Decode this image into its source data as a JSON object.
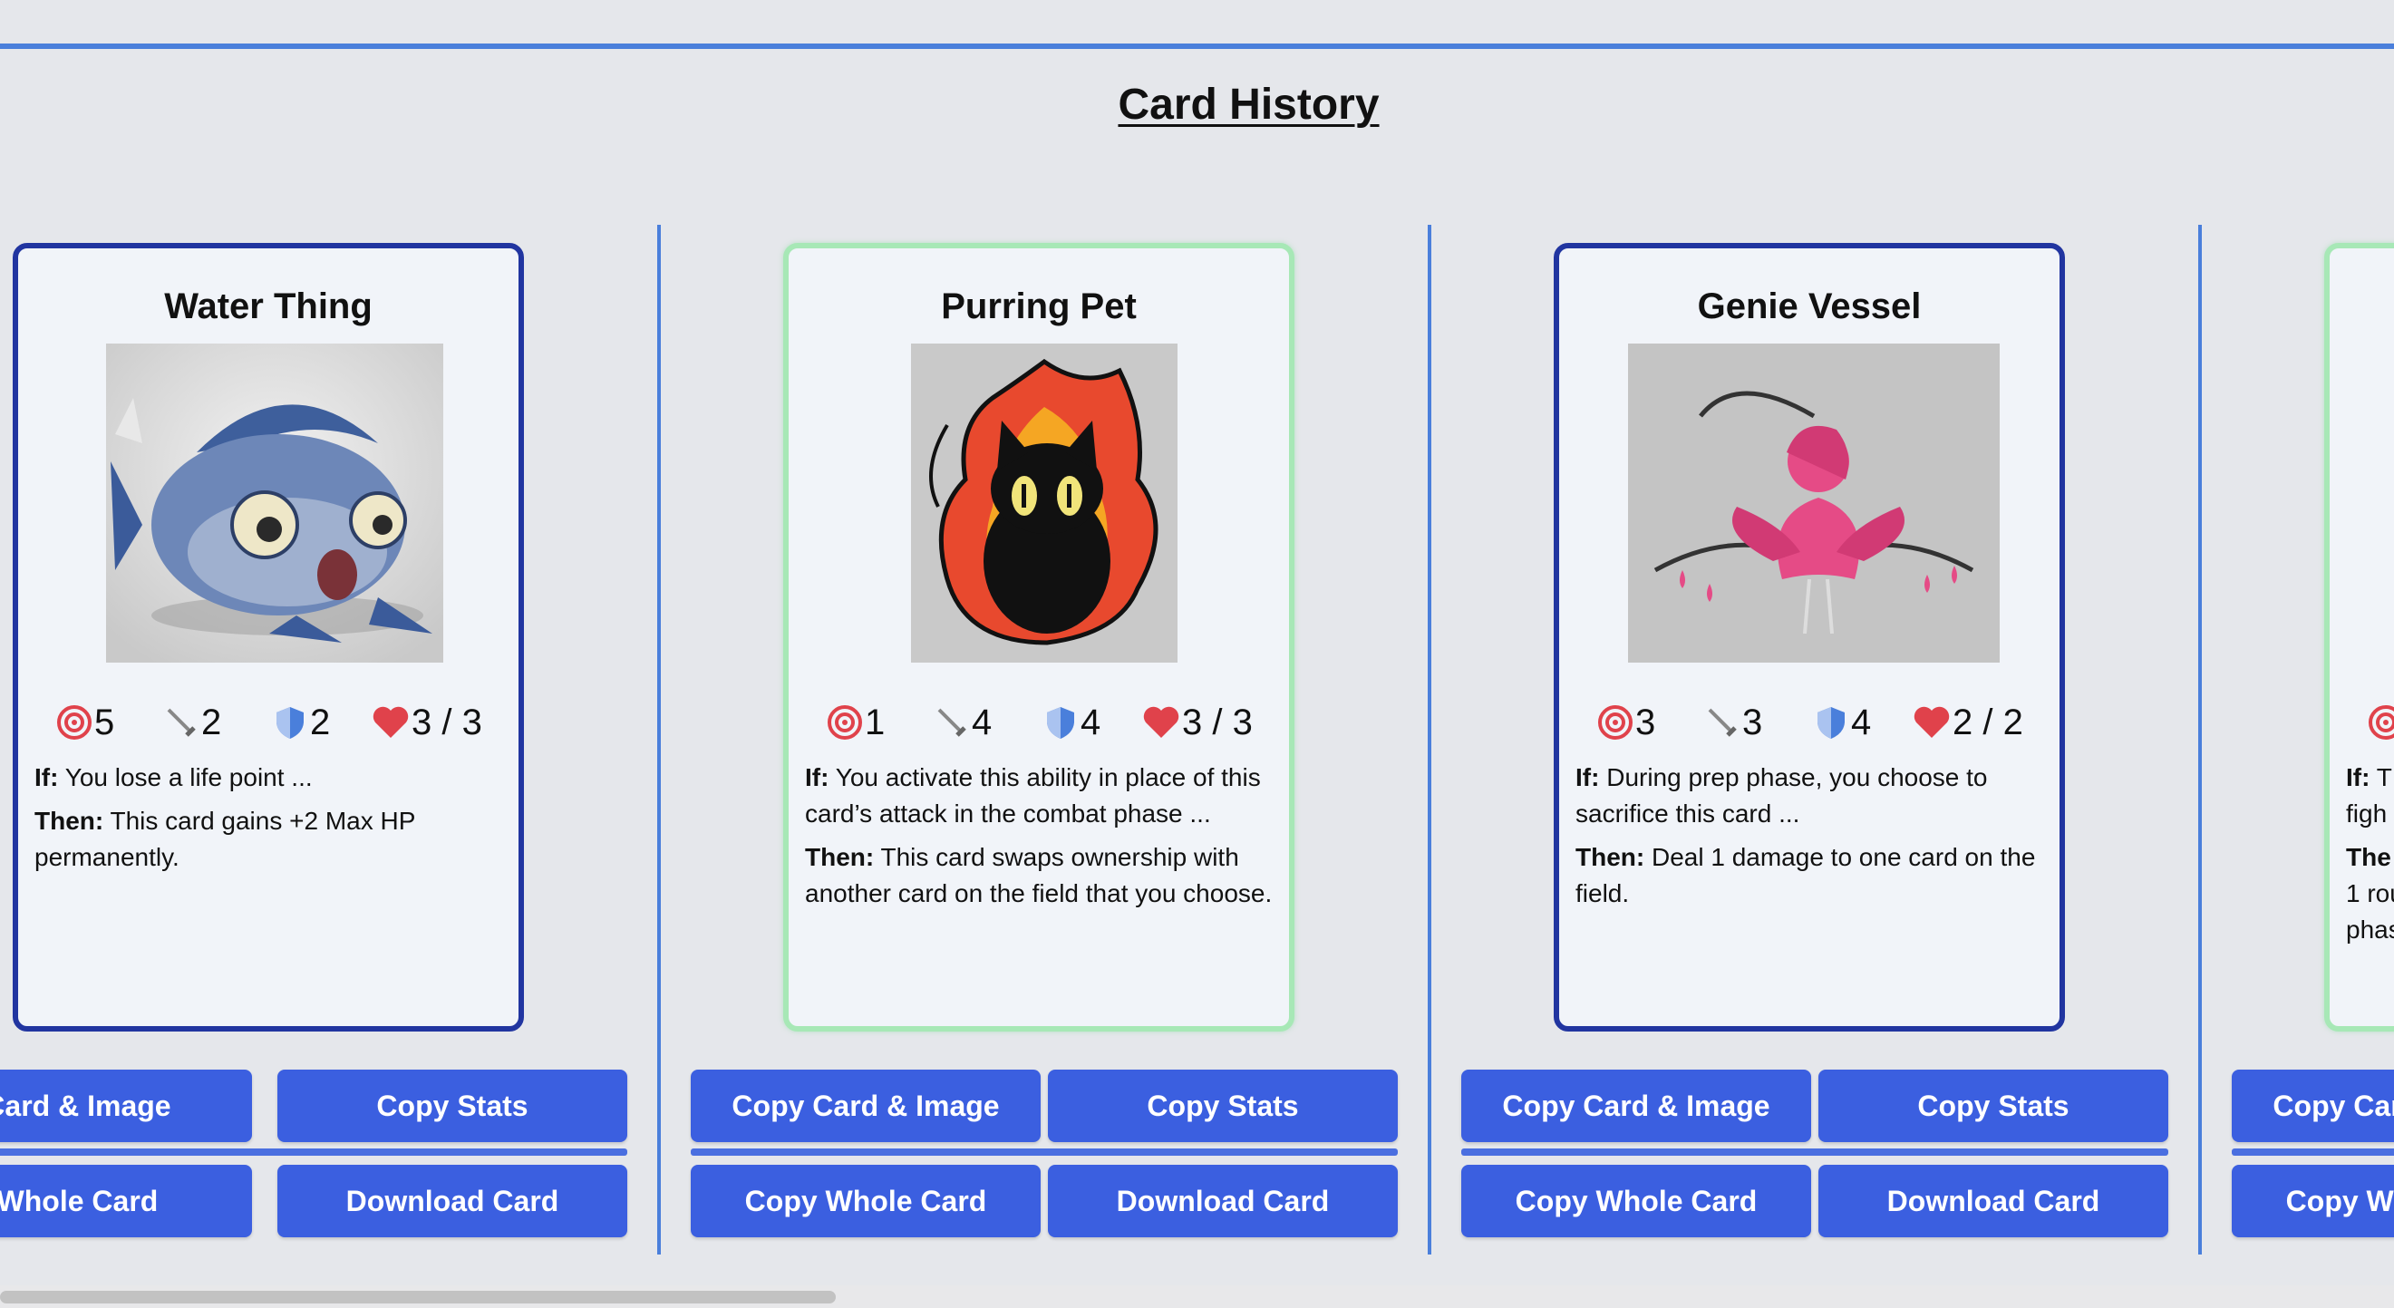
{
  "page": {
    "title": "Card History"
  },
  "buttons": {
    "copy_card_image": "Copy Card & Image",
    "copy_stats": "Copy Stats",
    "copy_whole_card": "Copy Whole Card",
    "download_card": "Download Card"
  },
  "cards": [
    {
      "name": "Water Thing",
      "target": "5",
      "attack": "2",
      "defense": "2",
      "hp": "3 / 3",
      "if_label": "If:",
      "if_text": " You lose a life point ...",
      "then_label": "Then:",
      "then_text": " This card gains +2 Max HP permanently.",
      "border": "#2135a0",
      "art_icon": "fish-illustration"
    },
    {
      "name": "Purring Pet",
      "target": "1",
      "attack": "4",
      "defense": "4",
      "hp": "3 / 3",
      "if_label": "If:",
      "if_text": " You activate this ability in place of this card’s attack in the combat phase ...",
      "then_label": "Then:",
      "then_text": " This card swaps ownership with another card on the field that you choose.",
      "border": "#a7e8b6",
      "art_icon": "fire-cat-illustration"
    },
    {
      "name": "Genie Vessel",
      "target": "3",
      "attack": "3",
      "defense": "4",
      "hp": "2 / 2",
      "if_label": "If:",
      "if_text": " During prep phase, you choose to sacrifice this card ...",
      "then_label": "Then:",
      "then_text": " Deal 1 damage to one card on the field.",
      "border": "#2135a0",
      "art_icon": "flower-fairy-illustration"
    },
    {
      "partial": true,
      "if_label": "If:",
      "if_text": " T",
      "if_text2": "figh",
      "then_label": "The",
      "then_text2": "1 rou",
      "then_text3": "phas",
      "border": "#a7e8b6"
    }
  ],
  "colors": {
    "accent": "#4a7fdb",
    "button": "#3b5fe0",
    "target": "#e0424b",
    "heart": "#e0424b",
    "shield": "#4a7fdb"
  }
}
